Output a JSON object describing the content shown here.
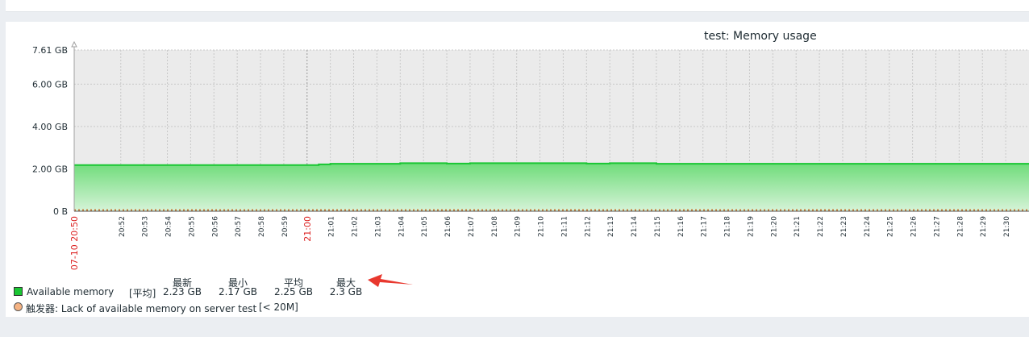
{
  "chart_data": {
    "type": "area",
    "title": "test: Memory usage",
    "ylabel": "",
    "xlabel": "",
    "ylim": [
      0,
      7.61
    ],
    "y_unit": "GB",
    "y_ticks": [
      "0 B",
      "2.00 GB",
      "4.00 GB",
      "6.00 GB",
      "7.61 GB"
    ],
    "y_tick_values": [
      0,
      2.0,
      4.0,
      6.0,
      7.61
    ],
    "x_start_label": "07-10 20:50",
    "x_tick_labels": [
      "20:52",
      "20:53",
      "20:54",
      "20:55",
      "20:56",
      "20:57",
      "20:58",
      "20:59",
      "21:00",
      "21:01",
      "21:02",
      "21:03",
      "21:04",
      "21:05",
      "21:06",
      "21:07",
      "21:08",
      "21:09",
      "21:10",
      "21:11",
      "21:12",
      "21:13",
      "21:14",
      "21:15",
      "21:16",
      "21:17",
      "21:18",
      "21:19",
      "21:20",
      "21:21",
      "21:22",
      "21:23",
      "21:24",
      "21:25",
      "21:26",
      "21:27",
      "21:28",
      "21:29",
      "21:30"
    ],
    "highlight_ticks": [
      "07-10 20:50",
      "21:00"
    ],
    "grid": true,
    "series": [
      {
        "name": "Available memory",
        "color": "#1ac633",
        "x": [
          "20:50",
          "20:51",
          "20:52",
          "20:53",
          "20:54",
          "20:55",
          "20:56",
          "20:57",
          "20:58",
          "20:59",
          "21:00",
          "21:00.5",
          "21:01",
          "21:02",
          "21:03",
          "21:04",
          "21:05",
          "21:06",
          "21:07",
          "21:08",
          "21:09",
          "21:10",
          "21:11",
          "21:12",
          "21:13",
          "21:14",
          "21:15",
          "21:16",
          "21:17",
          "21:18",
          "21:19",
          "21:20",
          "21:21",
          "21:22",
          "21:23",
          "21:24",
          "21:25",
          "21:26",
          "21:27",
          "21:28",
          "21:29",
          "21:30",
          "21:31"
        ],
        "values": [
          2.18,
          2.18,
          2.18,
          2.18,
          2.18,
          2.18,
          2.18,
          2.18,
          2.18,
          2.18,
          2.18,
          2.21,
          2.24,
          2.24,
          2.24,
          2.27,
          2.27,
          2.25,
          2.27,
          2.27,
          2.27,
          2.27,
          2.27,
          2.25,
          2.27,
          2.27,
          2.24,
          2.24,
          2.24,
          2.24,
          2.24,
          2.24,
          2.24,
          2.24,
          2.24,
          2.24,
          2.24,
          2.24,
          2.24,
          2.24,
          2.24,
          2.24,
          2.24
        ]
      }
    ],
    "threshold": {
      "value": 0.02,
      "color": "#c47c3a"
    }
  },
  "legend": {
    "item1": {
      "name": "Available memory",
      "func": "[平均]",
      "stats": [
        "2.23 GB",
        "2.17 GB",
        "2.25 GB",
        "2.3 GB"
      ]
    },
    "stat_headers": [
      "最新",
      "最小",
      "平均",
      "最大"
    ],
    "trigger": {
      "prefix": "触发器",
      "text": ": Lack of available memory on server test",
      "cond": "[< 20M]"
    }
  },
  "colors": {
    "area_top": "#1ac633",
    "grid_bg": "#ebebeb",
    "highlight": "#dc2222",
    "arrow": "#e8382e"
  }
}
